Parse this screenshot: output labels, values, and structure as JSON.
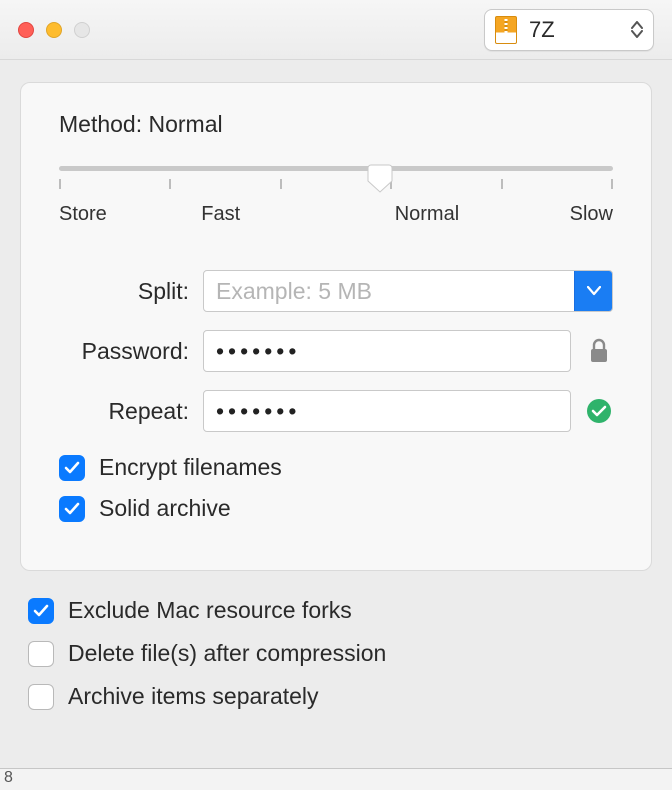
{
  "format": {
    "selected": "7Z"
  },
  "method": {
    "prefix": "Method: ",
    "value": "Normal",
    "sliderPercent": 58,
    "labels": {
      "store": "Store",
      "fast": "Fast",
      "normal": "Normal",
      "slow": "Slow"
    }
  },
  "fields": {
    "split": {
      "label": "Split:",
      "placeholder": "Example: 5 MB",
      "value": ""
    },
    "password": {
      "label": "Password:",
      "value": "•••••••"
    },
    "repeat": {
      "label": "Repeat:",
      "value": "•••••••"
    }
  },
  "panelChecks": {
    "encryptFilenames": {
      "label": "Encrypt filenames",
      "checked": true
    },
    "solidArchive": {
      "label": "Solid archive",
      "checked": true
    }
  },
  "outerChecks": {
    "excludeMacForks": {
      "label": "Exclude Mac resource forks",
      "checked": true
    },
    "deleteAfter": {
      "label": "Delete file(s) after compression",
      "checked": false
    },
    "archiveSeparately": {
      "label": "Archive items separately",
      "checked": false
    }
  },
  "footer": {
    "pageHint": "8"
  }
}
